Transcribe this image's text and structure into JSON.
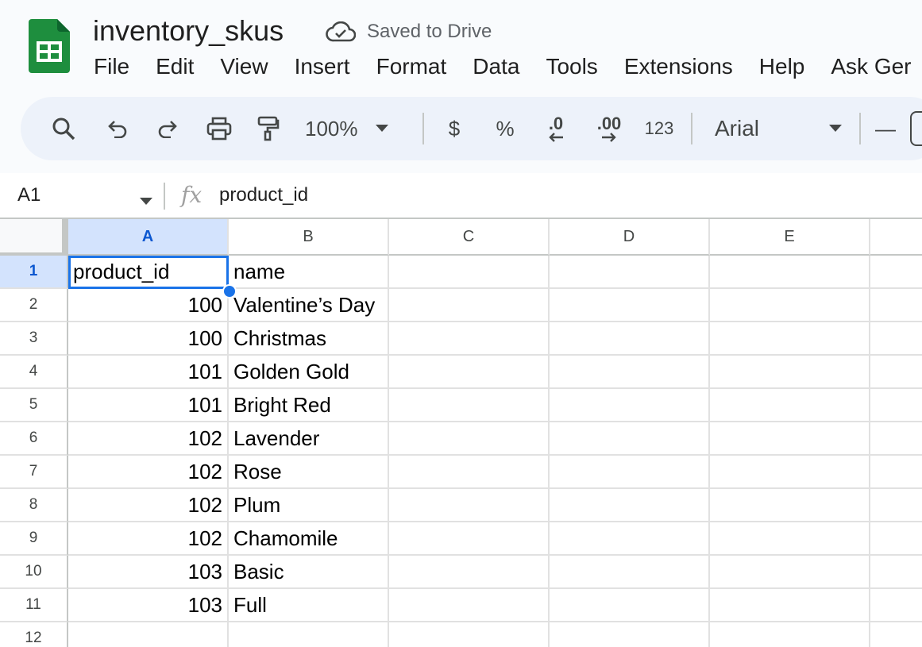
{
  "app": {
    "doc_title": "inventory_skus",
    "save_status": "Saved to Drive",
    "logo_icon": "google-sheets-logo"
  },
  "menu": [
    "File",
    "Edit",
    "View",
    "Insert",
    "Format",
    "Data",
    "Tools",
    "Extensions",
    "Help",
    "Ask Ger"
  ],
  "toolbar": {
    "icons": [
      "search-icon",
      "undo-icon",
      "redo-icon",
      "print-icon",
      "paint-format-icon"
    ],
    "zoom": "100%",
    "currency": "$",
    "percent": "%",
    "decrease_decimal": ".0",
    "increase_decimal": ".00",
    "number_format": "123",
    "font": "Arial",
    "font_size_minus": "—"
  },
  "formula_bar": {
    "name_box": "A1",
    "fx": "fx",
    "value": "product_id"
  },
  "sheet": {
    "columns": [
      "A",
      "B",
      "C",
      "D",
      "E"
    ],
    "selected_column": "A",
    "selected_row": "1",
    "row_numbers": [
      "1",
      "2",
      "3",
      "4",
      "5",
      "6",
      "7",
      "8",
      "9",
      "10",
      "11",
      "12"
    ],
    "rows": [
      [
        "product_id",
        "name"
      ],
      [
        "100",
        "Valentine’s Day"
      ],
      [
        "100",
        "Christmas"
      ],
      [
        "101",
        "Golden Gold"
      ],
      [
        "101",
        "Bright Red"
      ],
      [
        "102",
        "Lavender"
      ],
      [
        "102",
        "Rose"
      ],
      [
        "102",
        "Plum"
      ],
      [
        "102",
        "Chamomile"
      ],
      [
        "103",
        "Basic"
      ],
      [
        "103",
        "Full"
      ]
    ]
  },
  "colors": {
    "brand_green": "#1e8e3e",
    "accent_blue": "#1a73e8",
    "selection_fill": "#d3e3fd",
    "toolbar_bg": "#edf2fa"
  }
}
